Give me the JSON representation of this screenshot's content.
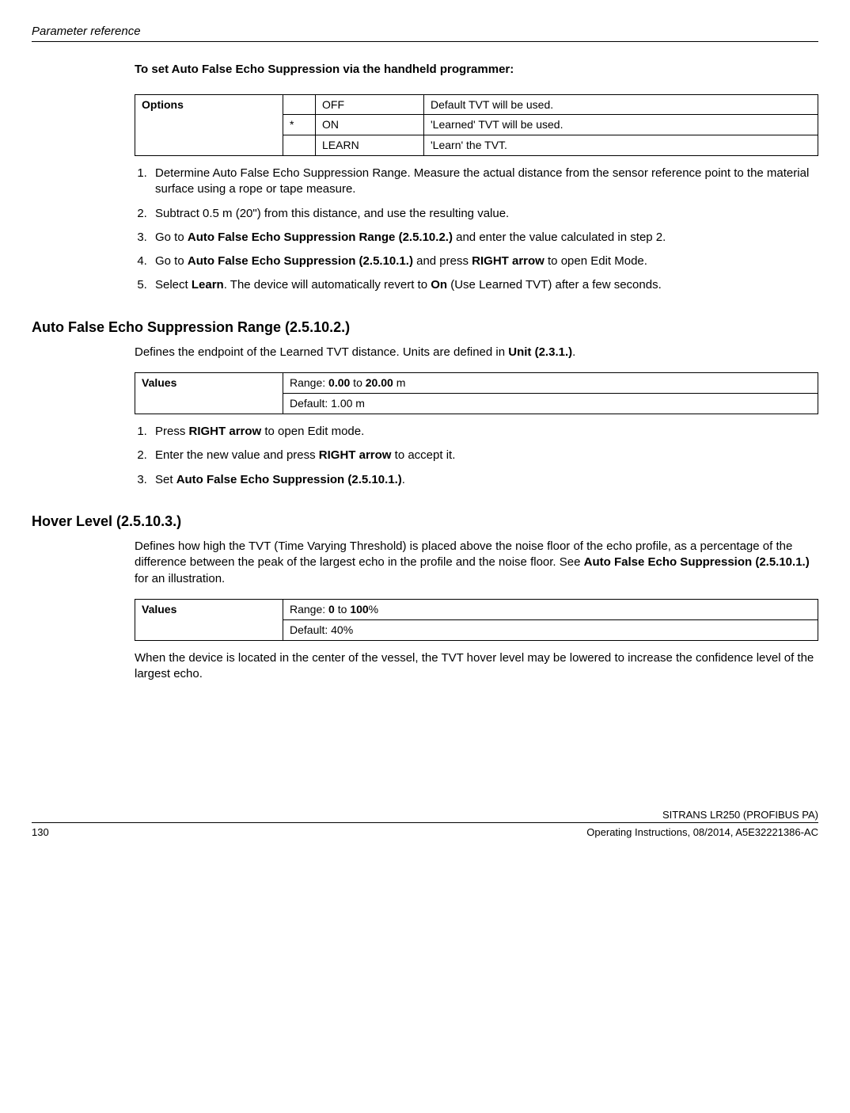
{
  "header": {
    "running": "Parameter reference",
    "section_title": "To set Auto False Echo Suppression via the handheld programmer:"
  },
  "table1": {
    "label": "Options",
    "rows": [
      {
        "star": "",
        "value": "OFF",
        "desc": "Default TVT will be used."
      },
      {
        "star": "*",
        "value": "ON",
        "desc": "'Learned' TVT will be used."
      },
      {
        "star": "",
        "value": "LEARN",
        "desc": "'Learn' the TVT."
      }
    ]
  },
  "list1": {
    "i1": "Determine Auto False Echo Suppression Range. Measure the actual distance from the sensor reference point to the material surface using a rope or tape measure.",
    "i2": "Subtract 0.5 m (20\") from this distance, and use the resulting value.",
    "i3a": "Go to ",
    "i3b": "Auto False Echo Suppression Range (2.5.10.2.)",
    "i3c": " and enter the value calculated in step 2.",
    "i4a": "Go to ",
    "i4b": "Auto False Echo Suppression (2.5.10.1.)",
    "i4c": " and press ",
    "i4d": "RIGHT arrow",
    "i4e": " to open Edit Mode.",
    "i5a": "Select ",
    "i5b": "Learn",
    "i5c": ". The device will automatically revert to ",
    "i5d": "On",
    "i5e": " (Use Learned TVT) after a few seconds."
  },
  "h2a": "Auto False Echo Suppression Range (2.5.10.2.)",
  "para_a1a": "Defines the endpoint of the Learned TVT distance. Units are defined in ",
  "para_a1b": "Unit (2.3.1.)",
  "para_a1c": ".",
  "table2": {
    "label": "Values",
    "r1a": "Range: ",
    "r1b": "0.00",
    "r1c": " to ",
    "r1d": "20.00",
    "r1e": " m",
    "r2": "Default: 1.00 m"
  },
  "list2": {
    "i1a": "Press ",
    "i1b": "RIGHT arrow",
    "i1c": " to open Edit mode.",
    "i2a": "Enter the new value and press ",
    "i2b": "RIGHT arrow",
    "i2c": " to accept it.",
    "i3a": "Set ",
    "i3b": "Auto False Echo Suppression (2.5.10.1.)",
    "i3c": "."
  },
  "h2b": "Hover Level (2.5.10.3.)",
  "para_b1a": "Defines how high the TVT (Time Varying Threshold) is placed above the noise floor of the echo profile, as a percentage of the difference between the peak of the largest echo in the profile and the noise floor. See ",
  "para_b1b": "Auto False Echo Suppression (2.5.10.1.)",
  "para_b1c": " for an illustration.",
  "table3": {
    "label": "Values",
    "r1a": "Range: ",
    "r1b": "0",
    "r1c": " to ",
    "r1d": "100",
    "r1e": "%",
    "r2": "Default: 40%"
  },
  "para_b2": "When the device is located in the center of the vessel, the TVT hover level may be lowered to increase the confidence level of the largest echo.",
  "footer": {
    "page": "130",
    "right1": "SITRANS LR250 (PROFIBUS PA)",
    "right2": "Operating Instructions, 08/2014, A5E32221386-AC"
  }
}
